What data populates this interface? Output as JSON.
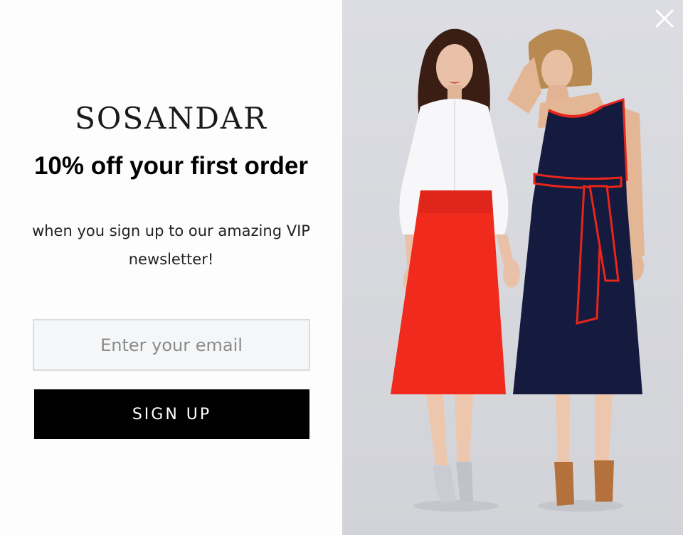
{
  "brand": {
    "name": "SOSANDAR"
  },
  "offer": {
    "headline": "10% off your first order",
    "subline": "when you sign up to our amazing VIP newsletter!"
  },
  "form": {
    "email_placeholder": "Enter your email",
    "email_value": "",
    "signup_label": "SIGN UP"
  },
  "icons": {
    "close": "close-icon"
  },
  "colors": {
    "button_bg": "#000000",
    "button_text": "#ffffff",
    "photo_bg": "#d9dadf",
    "skirt_red": "#f02a1c",
    "dress_navy": "#141b3f"
  }
}
